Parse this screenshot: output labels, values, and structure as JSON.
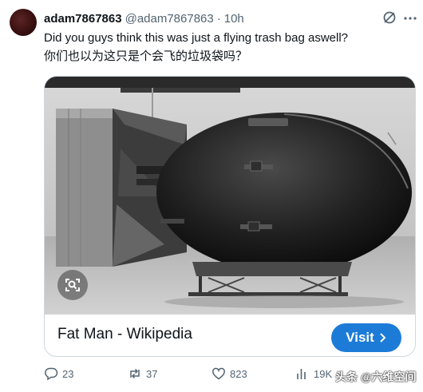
{
  "tweet": {
    "display_name": "adam7867863",
    "handle": "@adam7867863",
    "separator": "·",
    "time": "10h",
    "text_line1": "Did you guys think this was just a flying trash bag aswell?",
    "text_line2": "你们也以为这只是个会飞的垃圾袋吗？"
  },
  "card": {
    "title": "Fat Man - Wikipedia",
    "visit_label": "Visit",
    "image_subject": "black-and-white photo of the Fat Man bomb"
  },
  "actions": {
    "replies": "23",
    "reposts": "37",
    "likes": "823",
    "views": "19K"
  },
  "watermark": "头条 @六维空间",
  "icons": [
    "grok-icon",
    "more-icon",
    "image-search-icon",
    "chevron-right-icon",
    "reply-icon",
    "repost-icon",
    "like-icon",
    "views-icon"
  ],
  "colors": {
    "accent": "#1d7bd8",
    "secondary_text": "#536471",
    "border": "#cfd9de"
  }
}
